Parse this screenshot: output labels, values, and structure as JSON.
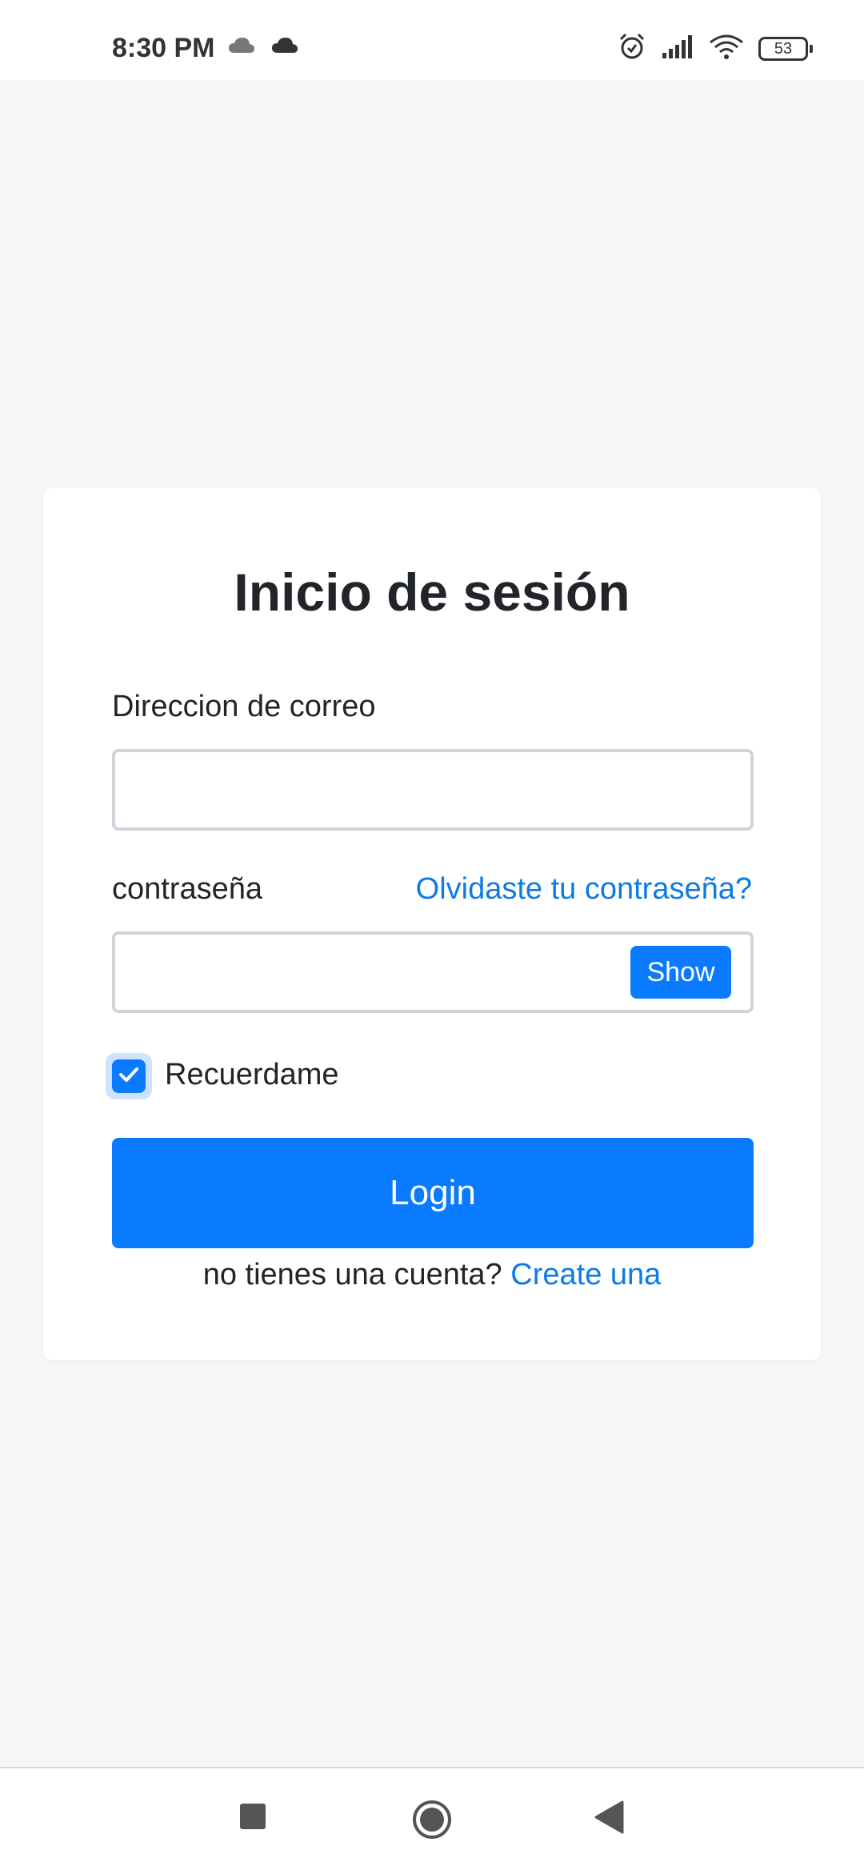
{
  "status_bar": {
    "time": "8:30 PM",
    "battery": "53",
    "icons": [
      "cloud-icon",
      "cloud-icon",
      "alarm-icon",
      "signal-icon",
      "wifi-icon",
      "battery-icon"
    ]
  },
  "login": {
    "title": "Inicio de sesión",
    "email_label": "Direccion de correo",
    "email_value": "",
    "password_label": "contraseña",
    "forgot_link": "Olvidaste tu contraseña?",
    "password_value": "",
    "show_button": "Show",
    "remember_label": "Recuerdame",
    "remember_checked": true,
    "login_button": "Login",
    "no_account_text": "no tienes una cuenta?",
    "create_link": "Create una"
  },
  "colors": {
    "primary": "#0a7bff",
    "link": "#0d7be6",
    "background": "#f6f7f9"
  },
  "nav_bar": {
    "icons": [
      "square-recents-icon",
      "circle-home-icon",
      "triangle-back-icon"
    ]
  }
}
